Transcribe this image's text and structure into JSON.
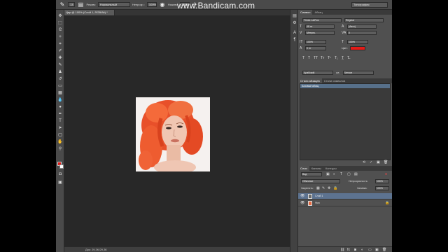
{
  "watermark": "www.Bandicam.com",
  "options_bar": {
    "mode_label": "Режим:",
    "mode_value": "Нормальный",
    "opacity_label": "Непрозр.:",
    "opacity_value": "100%",
    "flow_label": "Нажим:",
    "flow_value": "100%",
    "brush_size": "13",
    "workspace": "Типография"
  },
  "document_tab": "Цвр @ 100% (Слой 1, RGB/8#) *",
  "status_bar": "Док: 29,3K/29,3K",
  "character_panel": {
    "tabs": [
      "Символ",
      "Абзац"
    ],
    "font_family": "Times LatRus",
    "font_style": "Regular",
    "font_size": "48 пт",
    "leading": "(Авто)",
    "kerning": "Метрич.",
    "tracking": "0",
    "vscale": "100%",
    "hscale": "100%",
    "baseline": "0 пт",
    "color_label": "Цвет:",
    "color_value": "#e31b17",
    "language": "Арабский",
    "antialias": "Четкое"
  },
  "paragraph_styles": {
    "tabs": [
      "Стили абзацев",
      "Стили символов"
    ],
    "items": [
      "Базовый абзац"
    ]
  },
  "layers_panel": {
    "tabs": [
      "Слои",
      "Каналы",
      "Контуры"
    ],
    "filter_kind": "Вид",
    "blend_mode": "Обычные",
    "opacity_label": "Непрозрачность:",
    "opacity_value": "100%",
    "lock_label": "Закрепить:",
    "fill_label": "Заливка:",
    "fill_value": "100%",
    "layers": [
      {
        "name": "Слой 1",
        "selected": true
      },
      {
        "name": "Фон",
        "selected": false
      }
    ]
  },
  "colors": {
    "foreground": "#e31b17",
    "background": "#ffffff",
    "canvas": "#282828",
    "ui_dark": "#3c3c3c"
  }
}
